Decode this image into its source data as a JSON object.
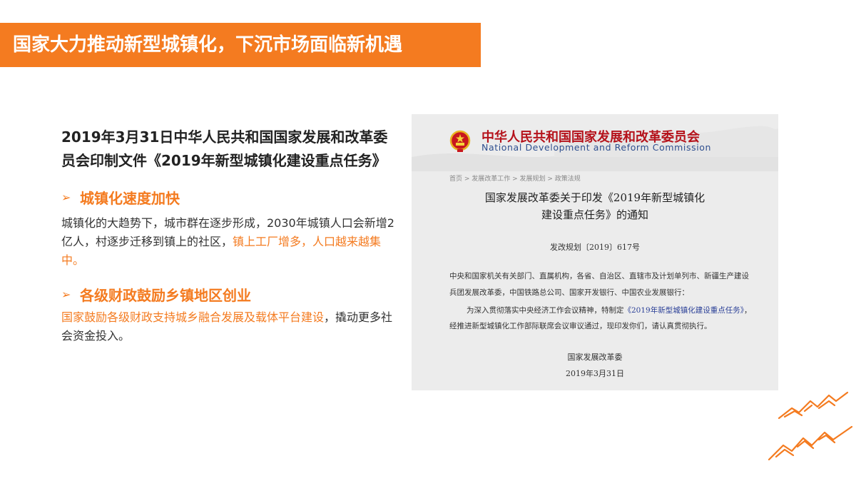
{
  "title": "国家大力推动新型城镇化，下沉市场面临新机遇",
  "left": {
    "heading": "2019年3月31日中华人民共和国国家发展和改革委员会印制文件《2019年新型城镇化建设重点任务》",
    "sections": [
      {
        "subtitle": "城镇化速度加快",
        "text_plain": "城镇化的大趋势下，城市群在逐步形成，2030年城镇人口会新增2亿人，村逐步迁移到镇上的社区，",
        "text_highlight": "镇上工厂增多，人口越来越集中。"
      },
      {
        "subtitle": "各级财政鼓励乡镇地区创业",
        "text_highlight": "国家鼓励各级财政支持城乡融合发展及载体平台建设",
        "text_plain": "，撬动更多社会资金投入。"
      }
    ],
    "bullet_symbol": "➢"
  },
  "document": {
    "org_cn": "中华人民共和国国家发展和改革委员会",
    "org_en": "National Development and Reform Commission",
    "breadcrumb": "首页 > 发展改革工作 > 发展规划 > 政策法规",
    "title_line1": "国家发展改革委关于印发《2019年新型城镇化",
    "title_line2": "建设重点任务》的通知",
    "doc_number": "发改规划〔2019〕617号",
    "para1": "中央和国家机关有关部门、直属机构，各省、自治区、直辖市及计划单列市、新疆生产建设",
    "para2": "兵团发展改革委，中国铁路总公司、国家开发银行、中国农业发展银行：",
    "para3_a": "为深入贯彻落实中央经济工作会议精神，特制定",
    "para3_link": "《2019年新型城镇化建设重点任务》",
    "para3_b": "，",
    "para4": "经推进新型城镇化工作部际联席会议审议通过，现印发你们，请认真贯彻执行。",
    "signer": "国家发展改革委",
    "date": "2019年3月31日"
  },
  "colors": {
    "accent": "#f47b20",
    "doc_red": "#b5121b",
    "doc_blue": "#2f4f8f"
  }
}
